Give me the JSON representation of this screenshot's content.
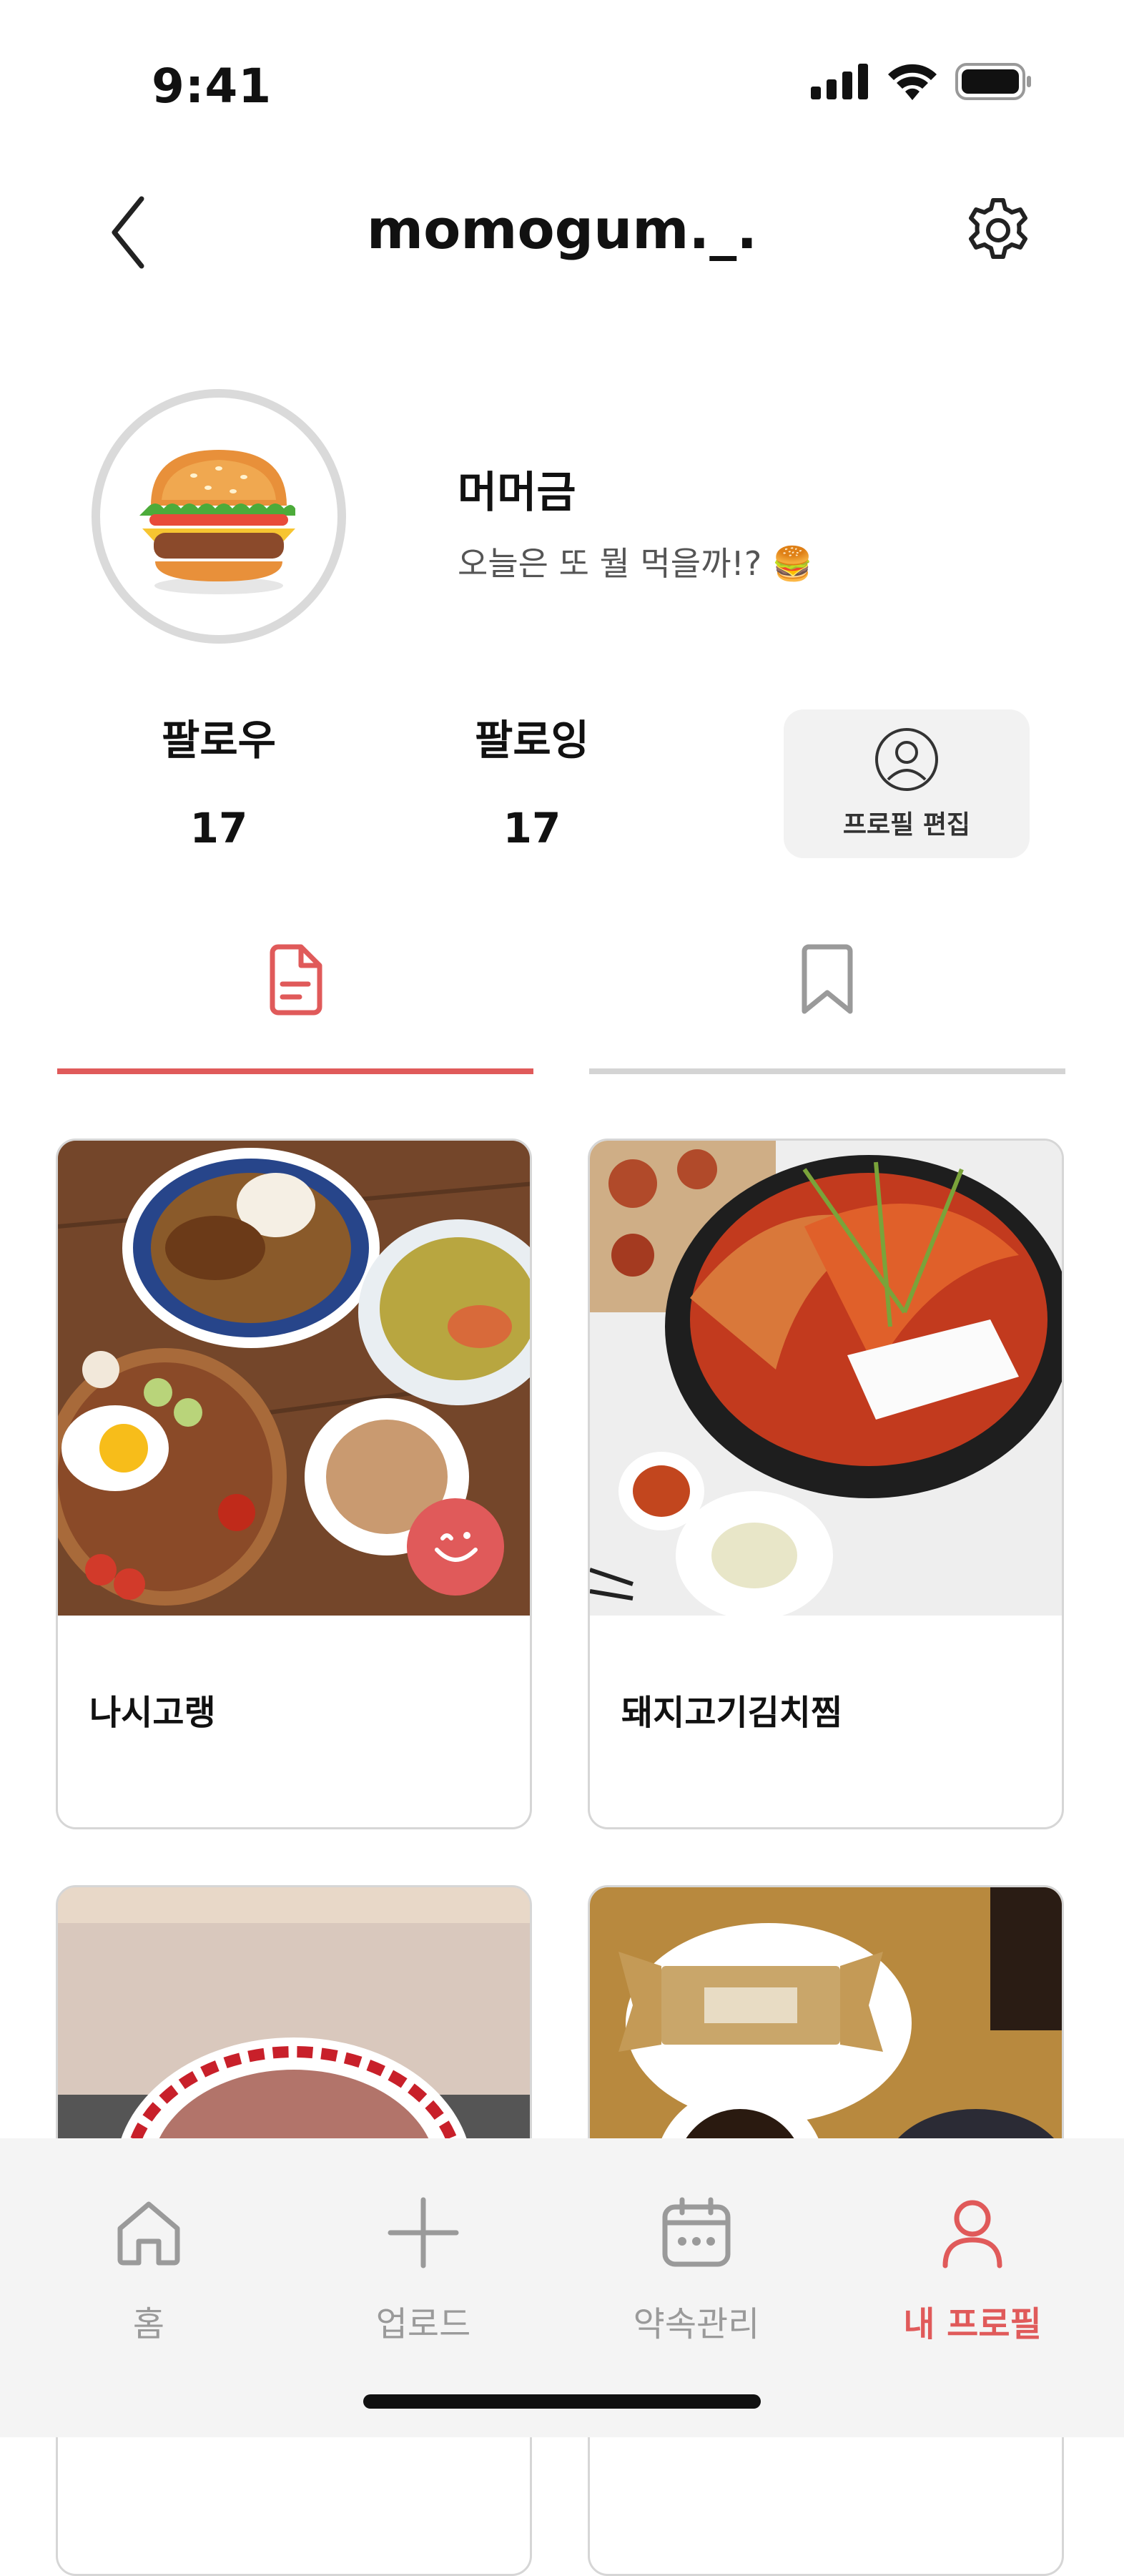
{
  "status_bar": {
    "time": "9:41"
  },
  "header": {
    "username": "momogum._."
  },
  "profile": {
    "display_name": "머머금",
    "bio": "오늘은 또 뭘 먹을까!? 🍔",
    "followers_label": "팔로우",
    "followers_count": "17",
    "following_label": "팔로잉",
    "following_count": "17",
    "edit_label": "프로필 편집"
  },
  "tabs": [
    {
      "icon": "document-icon",
      "active": true
    },
    {
      "icon": "bookmark-icon",
      "active": false
    }
  ],
  "posts": [
    {
      "title": "나시고랭"
    },
    {
      "title": "돼지고기김치찜"
    },
    {
      "title": ""
    },
    {
      "title": ""
    }
  ],
  "nav": [
    {
      "label": "홈",
      "icon": "home-icon"
    },
    {
      "label": "업로드",
      "icon": "plus-icon"
    },
    {
      "label": "약속관리",
      "icon": "calendar-icon"
    },
    {
      "label": "내 프로필",
      "icon": "person-icon",
      "active": true
    }
  ],
  "colors": {
    "accent": "#e05a5a",
    "inactive": "#9a9a9a",
    "tab_inactive_line": "#d4d4d4"
  }
}
